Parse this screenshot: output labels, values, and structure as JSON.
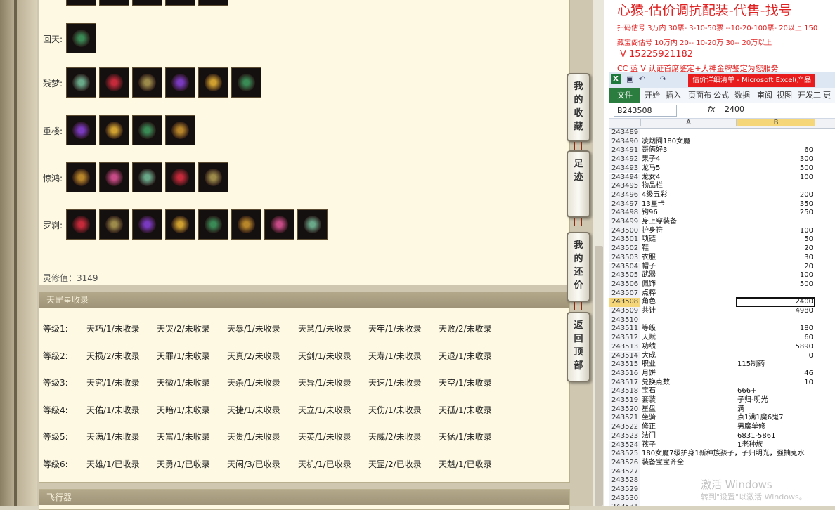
{
  "game": {
    "rows": [
      {
        "label": "回天:",
        "icons": [
          "jade-ring-icon"
        ]
      },
      {
        "label": "残梦:",
        "icons": [
          "mask-icon",
          "robe-icon",
          "butterfly-wing-icon",
          "cape-icon",
          "flower-hairpin-icon",
          "necklace-icon"
        ]
      },
      {
        "label": "重楼:",
        "icons": [
          "moon-helmet-icon",
          "golden-armor-icon",
          "dragon-ornament-icon",
          "gold-bracelet-icon"
        ]
      },
      {
        "label": "惊鸿:",
        "icons": [
          "jade-boots-icon",
          "skull-helmet-icon",
          "pearl-necklace-icon",
          "jellyfish-ornament-icon",
          "butterfly-mask-icon"
        ]
      },
      {
        "label": "罗刹:",
        "icons": [
          "dark-hat-icon",
          "red-robe-icon",
          "red-necklace-icon",
          "red-mask-icon",
          "ruby-ring-icon",
          "red-cape-icon",
          "red-flower-icon",
          "dark-armor-icon"
        ]
      }
    ],
    "xiuwei": "灵修值：3149",
    "tiangang": {
      "title": "天罡星收录",
      "rows": [
        {
          "level": "等级1:",
          "items": [
            "天巧/1/未收录",
            "天哭/2/未收录",
            "天暴/1/未收录",
            "天慧/1/未收录",
            "天牢/1/未收录",
            "天败/2/未收录"
          ]
        },
        {
          "level": "等级2:",
          "items": [
            "天损/2/未收录",
            "天罪/1/未收录",
            "天真/2/未收录",
            "天剑/1/未收录",
            "天寿/1/未收录",
            "天退/1/未收录"
          ]
        },
        {
          "level": "等级3:",
          "items": [
            "天究/1/未收录",
            "天微/1/未收录",
            "天杀/1/未收录",
            "天异/1/未收录",
            "天速/1/未收录",
            "天空/1/未收录"
          ]
        },
        {
          "level": "等级4:",
          "items": [
            "天佑/1/未收录",
            "天暗/1/未收录",
            "天捷/1/未收录",
            "天立/1/未收录",
            "天伤/1/未收录",
            "天孤/1/未收录"
          ]
        },
        {
          "level": "等级5:",
          "items": [
            "天满/1/未收录",
            "天富/1/未收录",
            "天贵/1/未收录",
            "天英/1/未收录",
            "天威/2/未收录",
            "天猛/1/未收录"
          ]
        },
        {
          "level": "等级6:",
          "items": [
            "天雄/1/已收录",
            "天勇/1/已收录",
            "天闲/3/已收录",
            "天机/1/已收录",
            "天罡/2/已收录",
            "天魁/1/已收录"
          ]
        }
      ]
    },
    "flight_title": "飞行器",
    "side_buttons": [
      {
        "label": [
          "我",
          "的",
          "收",
          "藏"
        ]
      },
      {
        "label": [
          "足",
          "迹"
        ]
      },
      {
        "label": [
          "我",
          "的",
          "还",
          "价"
        ]
      },
      {
        "label": [
          "返",
          "回",
          "顶",
          "部"
        ]
      }
    ]
  },
  "promo": {
    "line1": "心猿-估价调抗配装-代售-找号",
    "line2": "扫码估号 3万内 30票- 3-10-50票 --10-20-100票- 20以上 150",
    "line3": "藏宝阁估号 10万内 20-- 10-20万 30-- 20万以上",
    "line4": "V 15225921182",
    "line5": "CC 蓝 V 认证首席鉴定+大神金牌鉴定为您服务"
  },
  "excel": {
    "title": "估价详细清单 - Microsoft Excel(产品",
    "ribbon_tabs": [
      "文件",
      "开始",
      "插入",
      "页面布",
      "公式",
      "数据",
      "审阅",
      "视图",
      "开发工",
      "更"
    ],
    "name_box": "B243508",
    "fx": "fx",
    "formula_value": "2400",
    "columns": [
      "A",
      "B"
    ],
    "selected_row": "243508",
    "rows": [
      {
        "n": "243489",
        "a": "",
        "b": ""
      },
      {
        "n": "243490",
        "a": "凌烟阁180女魔",
        "b": ""
      },
      {
        "n": "243491",
        "a": "哥俩好3",
        "b": "60"
      },
      {
        "n": "243492",
        "a": "果子4",
        "b": "300"
      },
      {
        "n": "243493",
        "a": "龙马5",
        "b": "500"
      },
      {
        "n": "243494",
        "a": "龙女4",
        "b": "100"
      },
      {
        "n": "243495",
        "a": "物品栏",
        "b": ""
      },
      {
        "n": "243496",
        "a": "4级五彩",
        "b": "200"
      },
      {
        "n": "243497",
        "a": "13星卡",
        "b": "350"
      },
      {
        "n": "243498",
        "a": "钩96",
        "b": "250"
      },
      {
        "n": "243499",
        "a": "身上穿装备",
        "b": ""
      },
      {
        "n": "243500",
        "a": "护身符",
        "b": "100"
      },
      {
        "n": "243501",
        "a": "项链",
        "b": "50"
      },
      {
        "n": "243502",
        "a": "鞋",
        "b": "20"
      },
      {
        "n": "243503",
        "a": "衣服",
        "b": "30"
      },
      {
        "n": "243504",
        "a": "帽子",
        "b": "20"
      },
      {
        "n": "243505",
        "a": "武器",
        "b": "100"
      },
      {
        "n": "243506",
        "a": "佩饰",
        "b": "500"
      },
      {
        "n": "243507",
        "a": "点粹",
        "b": ""
      },
      {
        "n": "243508",
        "a": "角色",
        "b": "2400"
      },
      {
        "n": "243509",
        "a": "共计",
        "b": "4980"
      },
      {
        "n": "243510",
        "a": "",
        "b": ""
      },
      {
        "n": "243511",
        "a": "等级",
        "b": "180"
      },
      {
        "n": "243512",
        "a": "天赋",
        "b": "60"
      },
      {
        "n": "243513",
        "a": "功绩",
        "b": "5890"
      },
      {
        "n": "243514",
        "a": "大成",
        "b": "0"
      },
      {
        "n": "243515",
        "a": "职业",
        "b": "115制药"
      },
      {
        "n": "243516",
        "a": "月饼",
        "b": "46"
      },
      {
        "n": "243517",
        "a": "兑换点数",
        "b": "10"
      },
      {
        "n": "243518",
        "a": "宝石",
        "b": "666+"
      },
      {
        "n": "243519",
        "a": "套装",
        "b": "子归-明光"
      },
      {
        "n": "243520",
        "a": "星盘",
        "b": "满"
      },
      {
        "n": "243521",
        "a": "坐骑",
        "b": "点1满1魔6鬼7"
      },
      {
        "n": "243522",
        "a": "修正",
        "b": "男魔单修"
      },
      {
        "n": "243523",
        "a": "法门",
        "b": "6831-5861"
      },
      {
        "n": "243524",
        "a": "孩子",
        "b": "1老种族"
      },
      {
        "n": "243525",
        "a": "180女魔7级护身1新种族孩子，子归明光，强抽克水",
        "b": ""
      },
      {
        "n": "243526",
        "a": "装备宝宝齐全",
        "b": ""
      },
      {
        "n": "243527",
        "a": "",
        "b": ""
      },
      {
        "n": "243528",
        "a": "",
        "b": ""
      },
      {
        "n": "243529",
        "a": "",
        "b": ""
      },
      {
        "n": "243530",
        "a": "",
        "b": ""
      },
      {
        "n": "243531",
        "a": "",
        "b": ""
      }
    ],
    "watermark1": "激活 Windows",
    "watermark2": "转到\"设置\"以激活 Windows。"
  }
}
